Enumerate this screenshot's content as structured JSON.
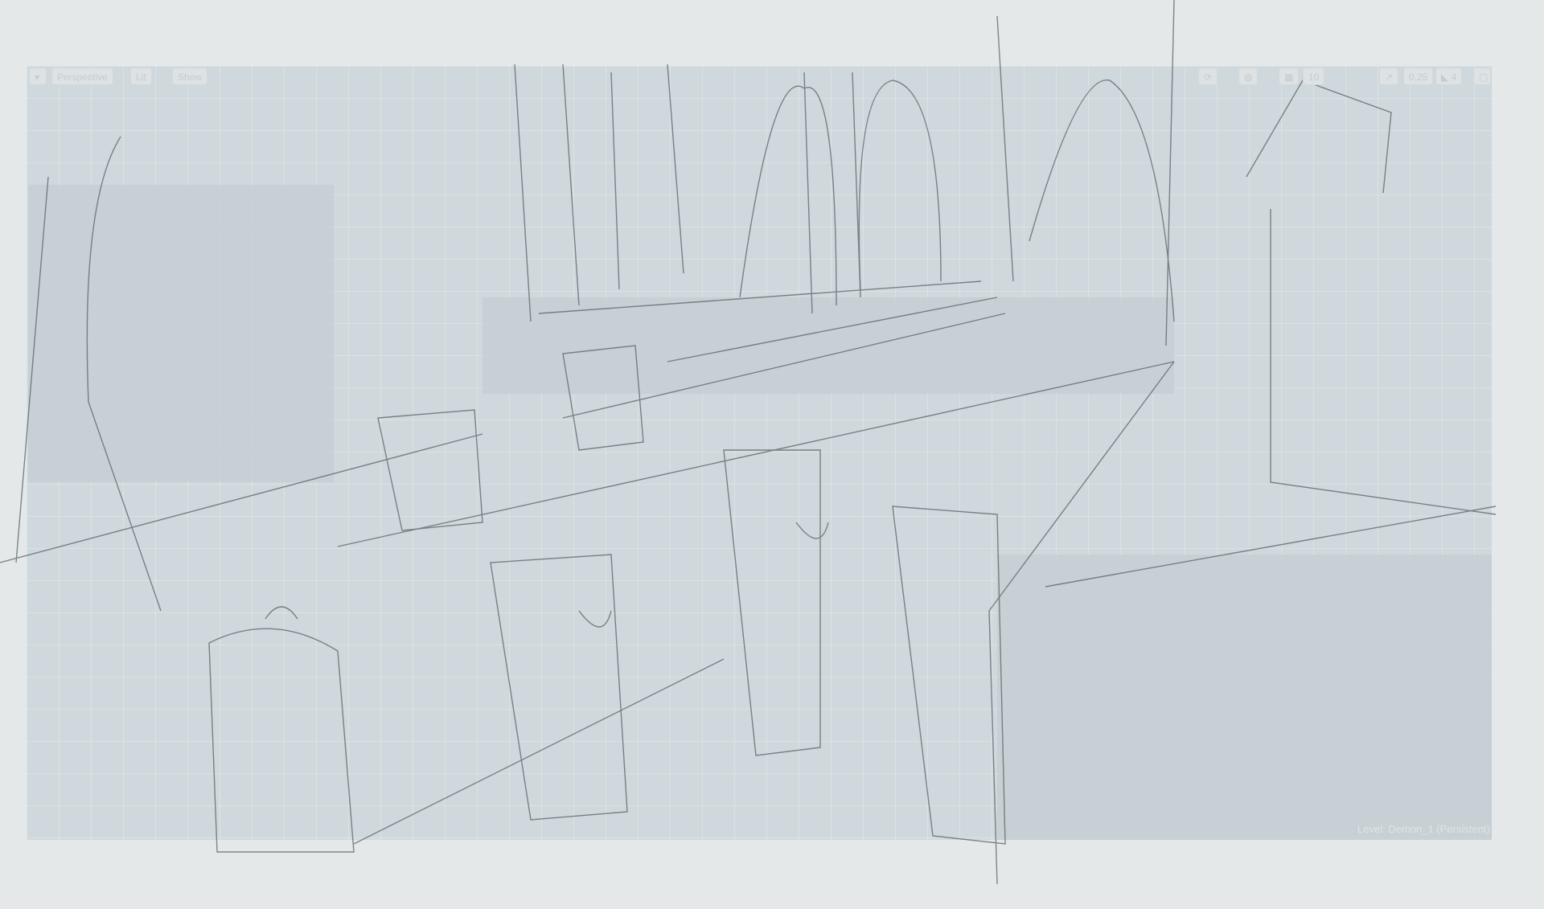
{
  "toolbar": {
    "menu_icon": "chevron-down-icon",
    "perspective": "Perspective",
    "lit": "Lit",
    "show": "Show",
    "snap_angle": "10",
    "camera_speed": "0.25",
    "speed_level": "4",
    "maximize_icon": "maximize-icon"
  },
  "status": {
    "level": "Level: Demon_1 (Persistent)"
  }
}
